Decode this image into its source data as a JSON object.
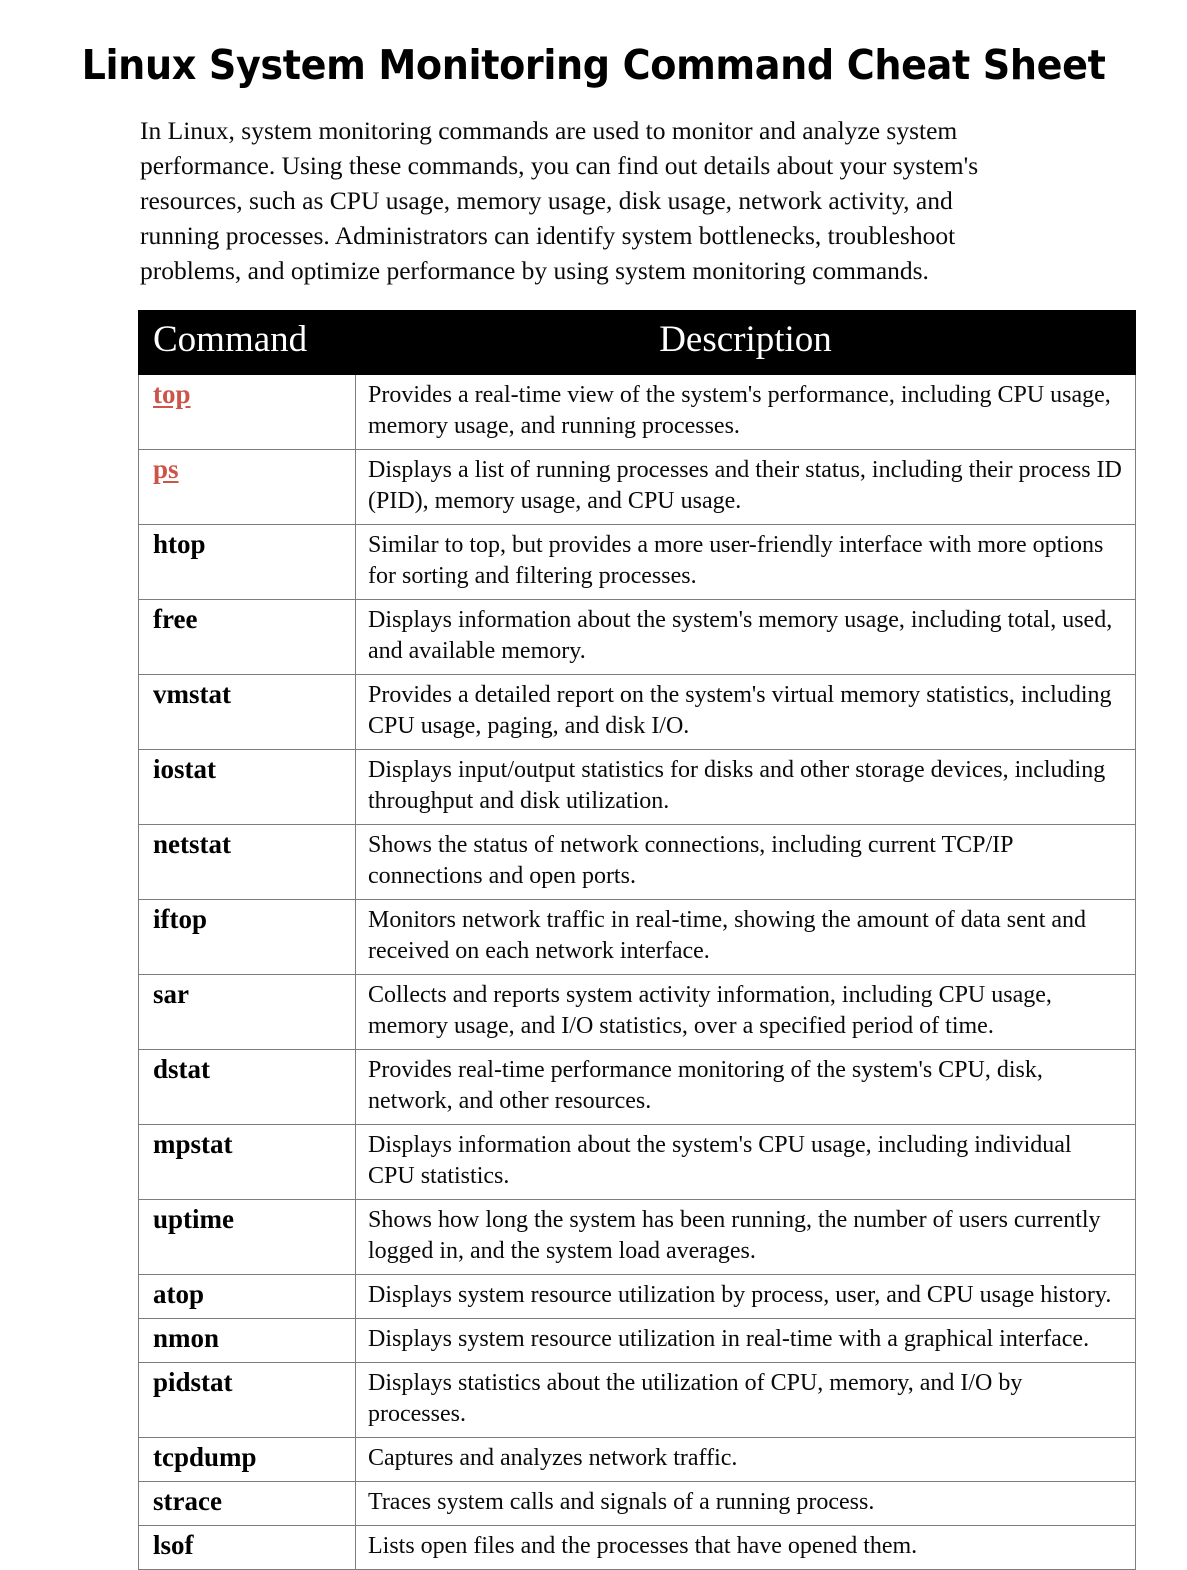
{
  "document": {
    "title": "Linux System Monitoring Command Cheat Sheet",
    "intro": "In Linux, system monitoring commands are used to monitor and analyze system performance. Using these commands, you can find out details about your system's resources, such as CPU usage, memory usage, disk usage, network activity, and running processes. Administrators can identify system bottlenecks, troubleshoot problems, and optimize performance by using system monitoring commands."
  },
  "colors": {
    "link": "#cc5449",
    "header_background": "#000000",
    "header_text": "#ffffff",
    "border": "#7d7d7d",
    "page_background": "#ffffff",
    "body_text": "#000000"
  },
  "table": {
    "headers": {
      "command": "Command",
      "description": "Description"
    },
    "rows": [
      {
        "command": "top",
        "is_link": true,
        "description": "Provides a real-time view of the system's performance, including CPU usage, memory usage, and running processes."
      },
      {
        "command": "ps",
        "is_link": true,
        "description": "Displays a list of running processes and their status, including their process ID (PID), memory usage, and CPU usage."
      },
      {
        "command": "htop",
        "is_link": false,
        "description": "Similar to top, but provides a more user-friendly interface with more options for sorting and filtering processes."
      },
      {
        "command": "free",
        "is_link": false,
        "description": "Displays information about the system's memory usage, including total, used, and available memory."
      },
      {
        "command": "vmstat",
        "is_link": false,
        "description": "Provides a detailed report on the system's virtual memory statistics, including CPU usage, paging, and disk I/O."
      },
      {
        "command": "iostat",
        "is_link": false,
        "description": "Displays input/output statistics for disks and other storage devices, including throughput and disk utilization."
      },
      {
        "command": "netstat",
        "is_link": false,
        "description": "Shows the status of network connections, including current TCP/IP connections and open ports."
      },
      {
        "command": "iftop",
        "is_link": false,
        "description": "Monitors network traffic in real-time, showing the amount of data sent and received on each network interface."
      },
      {
        "command": "sar",
        "is_link": false,
        "description": "Collects and reports system activity information, including CPU usage, memory usage, and I/O statistics, over a specified period of time."
      },
      {
        "command": "dstat",
        "is_link": false,
        "description": "Provides real-time performance monitoring of the system's CPU, disk, network, and other resources."
      },
      {
        "command": "mpstat",
        "is_link": false,
        "description": "Displays information about the system's CPU usage, including individual CPU statistics."
      },
      {
        "command": "uptime",
        "is_link": false,
        "description": "Shows how long the system has been running, the number of users currently logged in, and the system load averages."
      },
      {
        "command": "atop",
        "is_link": false,
        "description": "Displays system resource utilization by process, user, and CPU usage history."
      },
      {
        "command": "nmon",
        "is_link": false,
        "description": "Displays system resource utilization in real-time with a graphical interface."
      },
      {
        "command": "pidstat",
        "is_link": false,
        "description": "Displays statistics about the utilization of CPU, memory, and I/O by processes."
      },
      {
        "command": "tcpdump",
        "is_link": false,
        "description": "Captures and analyzes network traffic."
      },
      {
        "command": "strace",
        "is_link": false,
        "description": "Traces system calls and signals of a running process."
      },
      {
        "command": "lsof",
        "is_link": false,
        "description": "Lists open files and the processes that have opened them."
      }
    ]
  }
}
